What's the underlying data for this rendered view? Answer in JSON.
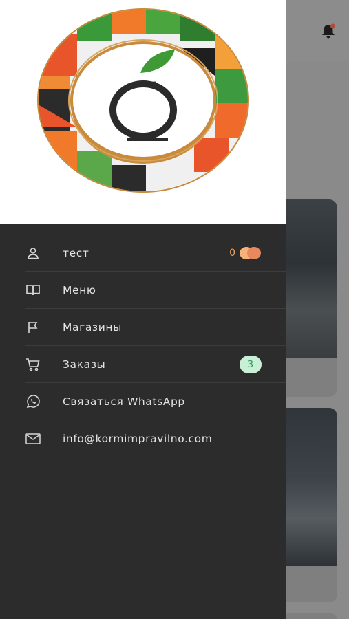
{
  "background": {
    "notification_icon": "bell-icon"
  },
  "drawer": {
    "logo_icon": "store-logo-icon",
    "menu": [
      {
        "icon": "user-icon",
        "label": "тест",
        "points": "0"
      },
      {
        "icon": "book-icon",
        "label": "Меню"
      },
      {
        "icon": "flag-icon",
        "label": "Магазины"
      },
      {
        "icon": "cart-icon",
        "label": "Заказы",
        "badge": "3"
      },
      {
        "icon": "whatsapp-icon",
        "label": "Связаться WhatsApp"
      },
      {
        "icon": "mail-icon",
        "label": "info@kormimpravilno.com"
      }
    ]
  },
  "colors": {
    "drawer_bg": "#2c2c2c",
    "text": "#e3e3e3",
    "points": "#f0a45c",
    "badge_bg": "#c9efd6",
    "badge_text": "#2e9a57"
  }
}
